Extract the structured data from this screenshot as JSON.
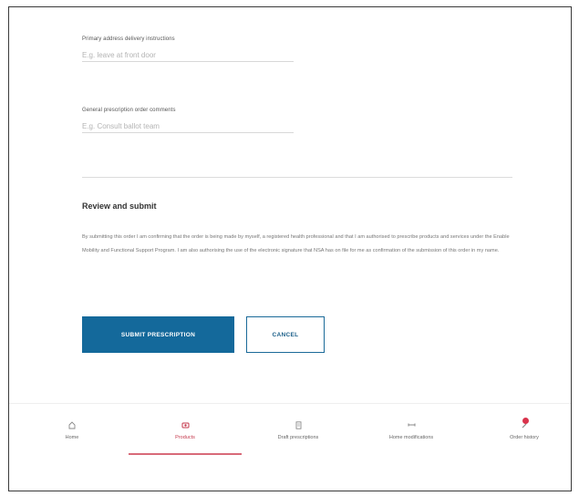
{
  "form": {
    "delivery": {
      "label": "Primary address delivery instructions",
      "placeholder": "E.g. leave at front door"
    },
    "comments": {
      "label": "General prescription order comments",
      "placeholder": "E.g. Consult ballot team"
    }
  },
  "review": {
    "title": "Review and submit",
    "body": "By submitting this order I am confirming that the order is being made by myself, a registered health professional and that I am authorised to prescribe products and services under the Enable Mobility and Functional Support Program. I am also authorising the use of the electronic signature that NSA has on file for me as confirmation of the submission of this order in my name."
  },
  "buttons": {
    "submit": "SUBMIT PRESCRIPTION",
    "cancel": "CANCEL"
  },
  "nav": {
    "items": [
      {
        "label": "Home",
        "icon": "home-icon"
      },
      {
        "label": "Products",
        "icon": "products-icon"
      },
      {
        "label": "Draft prescriptions",
        "icon": "draft-icon"
      },
      {
        "label": "Home modifications",
        "icon": "tools-icon"
      },
      {
        "label": "Order history",
        "icon": "history-icon"
      }
    ],
    "active": "Products"
  },
  "colors": {
    "primary": "#14699b",
    "accent": "#d9334c"
  }
}
